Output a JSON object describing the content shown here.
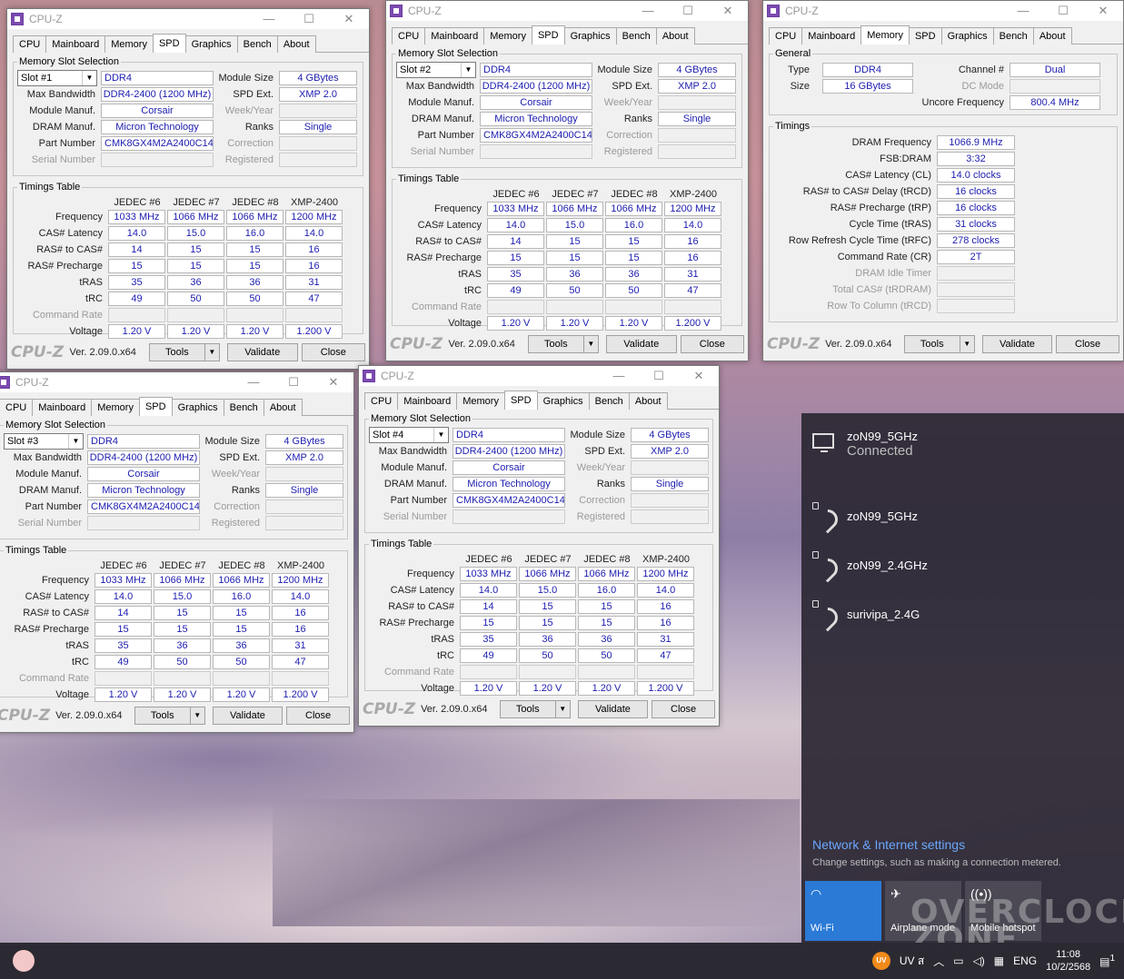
{
  "app_title": "CPU-Z",
  "win_controls": {
    "minimize": "—",
    "maximize": "☐",
    "close": "✕"
  },
  "tabs": [
    "CPU",
    "Mainboard",
    "Memory",
    "SPD",
    "Graphics",
    "Bench",
    "About"
  ],
  "spd_labels": {
    "group_slot": "Memory Slot Selection",
    "max_bandwidth": "Max Bandwidth",
    "module_manuf": "Module Manuf.",
    "dram_manuf": "DRAM Manuf.",
    "part_number": "Part Number",
    "serial_number": "Serial Number",
    "module_size": "Module Size",
    "spd_ext": "SPD Ext.",
    "week_year": "Week/Year",
    "ranks": "Ranks",
    "correction": "Correction",
    "registered": "Registered",
    "group_timings": "Timings Table",
    "frequency": "Frequency",
    "cas": "CAS# Latency",
    "ras_cas": "RAS# to CAS#",
    "ras_pre": "RAS# Precharge",
    "tras": "tRAS",
    "trc": "tRC",
    "cmd_rate": "Command Rate",
    "voltage": "Voltage"
  },
  "spd_common": {
    "type": "DDR4",
    "max_bandwidth": "DDR4-2400 (1200 MHz)",
    "module_manuf": "Corsair",
    "dram_manuf": "Micron Technology",
    "part_number": "CMK8GX4M2A2400C14",
    "module_size": "4 GBytes",
    "spd_ext": "XMP 2.0",
    "ranks": "Single",
    "timing_headers": [
      "JEDEC #6",
      "JEDEC #7",
      "JEDEC #8",
      "XMP-2400"
    ],
    "frequency": [
      "1033 MHz",
      "1066 MHz",
      "1066 MHz",
      "1200 MHz"
    ],
    "cas": [
      "14.0",
      "15.0",
      "16.0",
      "14.0"
    ],
    "ras_cas": [
      "14",
      "15",
      "15",
      "16"
    ],
    "ras_pre": [
      "15",
      "15",
      "15",
      "16"
    ],
    "tras": [
      "35",
      "36",
      "36",
      "31"
    ],
    "trc": [
      "49",
      "50",
      "50",
      "47"
    ],
    "voltage": [
      "1.20 V",
      "1.20 V",
      "1.20 V",
      "1.200 V"
    ]
  },
  "slots": [
    "Slot #1",
    "Slot #2",
    "Slot #3",
    "Slot #4"
  ],
  "footer": {
    "logo": "CPU-Z",
    "version": "Ver. 2.09.0.x64",
    "tools": "Tools",
    "validate": "Validate",
    "close": "Close"
  },
  "memory_tab": {
    "group_general": "General",
    "type_label": "Type",
    "type": "DDR4",
    "size_label": "Size",
    "size": "16 GBytes",
    "channel_label": "Channel #",
    "channel": "Dual",
    "dc_mode_label": "DC Mode",
    "uncore_label": "Uncore Frequency",
    "uncore": "800.4 MHz",
    "group_timings": "Timings",
    "rows": [
      {
        "label": "DRAM Frequency",
        "value": "1066.9 MHz",
        "dim": false
      },
      {
        "label": "FSB:DRAM",
        "value": "3:32",
        "dim": false
      },
      {
        "label": "CAS# Latency (CL)",
        "value": "14.0 clocks",
        "dim": false
      },
      {
        "label": "RAS# to CAS# Delay (tRCD)",
        "value": "16 clocks",
        "dim": false
      },
      {
        "label": "RAS# Precharge (tRP)",
        "value": "16 clocks",
        "dim": false
      },
      {
        "label": "Cycle Time (tRAS)",
        "value": "31 clocks",
        "dim": false
      },
      {
        "label": "Row Refresh Cycle Time (tRFC)",
        "value": "278 clocks",
        "dim": false
      },
      {
        "label": "Command Rate (CR)",
        "value": "2T",
        "dim": false
      },
      {
        "label": "DRAM Idle Timer",
        "value": "",
        "dim": true
      },
      {
        "label": "Total CAS# (tRDRAM)",
        "value": "",
        "dim": true
      },
      {
        "label": "Row To Column (tRCD)",
        "value": "",
        "dim": true
      }
    ]
  },
  "network": {
    "connected_name": "zoN99_5GHz",
    "connected_status": "Connected",
    "networks": [
      "zoN99_5GHz",
      "zoN99_2.4GHz",
      "surivipa_2.4G"
    ],
    "settings_link": "Network & Internet settings",
    "settings_sub": "Change settings, such as making a connection metered.",
    "quick_actions": [
      "Wi-Fi",
      "Airplane mode",
      "Mobile hotspot"
    ]
  },
  "watermark": "OVERCLOCK ZONE",
  "taskbar": {
    "uv_badge": "UV",
    "uv_text": "UV ส",
    "lang": "ENG",
    "time": "11:08",
    "date": "10/2/2568",
    "notif_count": "1"
  }
}
